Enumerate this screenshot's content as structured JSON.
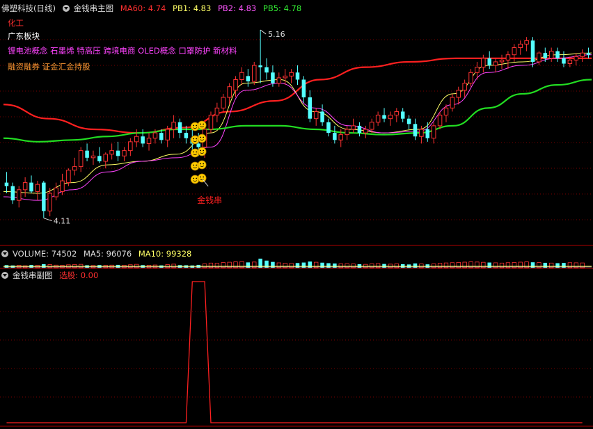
{
  "header": {
    "stock_name": "佛塑科技(日线)",
    "indicator_name": "金钱串主图",
    "ma60_label": "MA60:",
    "ma60_value": "4.74",
    "pb1_label": "PB1:",
    "pb1_value": "4.83",
    "pb2_label": "PB2:",
    "pb2_value": "4.83",
    "pb5_label": "PB5:",
    "pb5_value": "4.78"
  },
  "annotations": {
    "industry": "化工",
    "region": "广东板块",
    "concepts": "锂电池概念 石墨烯 特高压 跨境电商 OLED概念 口罩防护 新材料",
    "tags": "融资融券 证金汇金持股",
    "high_label": "5.16",
    "low_label": "4.11",
    "signal_label": "金钱串"
  },
  "volume_header": {
    "label": "VOLUME:",
    "value": "74502",
    "ma5_label": "MA5:",
    "ma5_value": "96076",
    "ma10_label": "MA10:",
    "ma10_value": "99328"
  },
  "sub_header": {
    "indicator_name": "金钱串副图",
    "select_label": "选股:",
    "select_value": "0.00"
  },
  "colors": {
    "up": "#ff3232",
    "down": "#54ffff",
    "ma60": "#ff2020",
    "pb1": "#ffff66",
    "pb2": "#ff44ff",
    "pb5": "#22dd22",
    "grid": "#7a0000",
    "signal": "#ff2020"
  },
  "chart_data": [
    {
      "type": "candlestick",
      "title": "金钱串主图",
      "ylim": [
        3.95,
        5.25
      ],
      "ohlc": [
        [
          4.3,
          4.36,
          4.24,
          4.28
        ],
        [
          4.28,
          4.3,
          4.18,
          4.2
        ],
        [
          4.2,
          4.28,
          4.16,
          4.26
        ],
        [
          4.26,
          4.33,
          4.22,
          4.3
        ],
        [
          4.3,
          4.34,
          4.24,
          4.25
        ],
        [
          4.25,
          4.31,
          4.2,
          4.29
        ],
        [
          4.3,
          4.31,
          4.1,
          4.14
        ],
        [
          4.14,
          4.27,
          4.11,
          4.24
        ],
        [
          4.22,
          4.3,
          4.2,
          4.27
        ],
        [
          4.25,
          4.35,
          4.23,
          4.31
        ],
        [
          4.3,
          4.38,
          4.28,
          4.37
        ],
        [
          4.37,
          4.44,
          4.34,
          4.39
        ],
        [
          4.39,
          4.5,
          4.36,
          4.48
        ],
        [
          4.48,
          4.52,
          4.42,
          4.44
        ],
        [
          4.44,
          4.48,
          4.4,
          4.45
        ],
        [
          4.45,
          4.5,
          4.41,
          4.42
        ],
        [
          4.42,
          4.47,
          4.38,
          4.46
        ],
        [
          4.46,
          4.52,
          4.43,
          4.48
        ],
        [
          4.48,
          4.53,
          4.42,
          4.45
        ],
        [
          4.45,
          4.5,
          4.42,
          4.48
        ],
        [
          4.48,
          4.55,
          4.45,
          4.53
        ],
        [
          4.53,
          4.6,
          4.5,
          4.56
        ],
        [
          4.56,
          4.6,
          4.5,
          4.52
        ],
        [
          4.52,
          4.58,
          4.48,
          4.55
        ],
        [
          4.55,
          4.6,
          4.52,
          4.58
        ],
        [
          4.58,
          4.6,
          4.52,
          4.54
        ],
        [
          4.54,
          4.62,
          4.5,
          4.6
        ],
        [
          4.6,
          4.68,
          4.55,
          4.64
        ],
        [
          4.64,
          4.66,
          4.55,
          4.58
        ],
        [
          4.58,
          4.62,
          4.52,
          4.55
        ],
        [
          4.55,
          4.6,
          4.48,
          4.52
        ],
        [
          4.52,
          4.58,
          4.45,
          4.5
        ],
        [
          4.5,
          4.62,
          4.44,
          4.6
        ],
        [
          4.6,
          4.7,
          4.58,
          4.68
        ],
        [
          4.68,
          4.75,
          4.64,
          4.72
        ],
        [
          4.72,
          4.8,
          4.7,
          4.78
        ],
        [
          4.78,
          4.86,
          4.74,
          4.84
        ],
        [
          4.82,
          4.9,
          4.78,
          4.88
        ],
        [
          4.88,
          4.95,
          4.85,
          4.92
        ],
        [
          4.9,
          4.94,
          4.84,
          4.87
        ],
        [
          4.87,
          4.98,
          4.85,
          4.96
        ],
        [
          4.96,
          5.16,
          4.86,
          4.95
        ],
        [
          4.95,
          5.0,
          4.88,
          4.92
        ],
        [
          4.92,
          4.96,
          4.84,
          4.86
        ],
        [
          4.86,
          4.92,
          4.84,
          4.89
        ],
        [
          4.89,
          4.94,
          4.85,
          4.9
        ],
        [
          4.9,
          4.94,
          4.86,
          4.92
        ],
        [
          4.92,
          4.96,
          4.85,
          4.88
        ],
        [
          4.88,
          4.9,
          4.75,
          4.78
        ],
        [
          4.78,
          4.82,
          4.64,
          4.66
        ],
        [
          4.66,
          4.72,
          4.62,
          4.7
        ],
        [
          4.7,
          4.74,
          4.62,
          4.64
        ],
        [
          4.64,
          4.66,
          4.56,
          4.58
        ],
        [
          4.58,
          4.62,
          4.52,
          4.54
        ],
        [
          4.54,
          4.6,
          4.5,
          4.57
        ],
        [
          4.57,
          4.62,
          4.54,
          4.6
        ],
        [
          4.6,
          4.66,
          4.58,
          4.62
        ],
        [
          4.62,
          4.64,
          4.56,
          4.58
        ],
        [
          4.58,
          4.62,
          4.55,
          4.6
        ],
        [
          4.6,
          4.66,
          4.58,
          4.64
        ],
        [
          4.64,
          4.7,
          4.62,
          4.68
        ],
        [
          4.68,
          4.72,
          4.64,
          4.66
        ],
        [
          4.66,
          4.7,
          4.62,
          4.68
        ],
        [
          4.68,
          4.72,
          4.64,
          4.7
        ],
        [
          4.7,
          4.72,
          4.64,
          4.66
        ],
        [
          4.66,
          4.68,
          4.6,
          4.63
        ],
        [
          4.63,
          4.66,
          4.54,
          4.56
        ],
        [
          4.56,
          4.62,
          4.52,
          4.6
        ],
        [
          4.6,
          4.64,
          4.53,
          4.55
        ],
        [
          4.55,
          4.64,
          4.52,
          4.62
        ],
        [
          4.62,
          4.7,
          4.6,
          4.68
        ],
        [
          4.68,
          4.74,
          4.64,
          4.72
        ],
        [
          4.72,
          4.8,
          4.7,
          4.78
        ],
        [
          4.78,
          4.84,
          4.74,
          4.82
        ],
        [
          4.82,
          4.88,
          4.78,
          4.86
        ],
        [
          4.86,
          4.94,
          4.84,
          4.92
        ],
        [
          4.92,
          4.98,
          4.88,
          4.95
        ],
        [
          4.95,
          5.02,
          4.92,
          5.0
        ],
        [
          5.0,
          5.04,
          4.94,
          4.96
        ],
        [
          4.96,
          5.0,
          4.92,
          4.98
        ],
        [
          4.98,
          5.02,
          4.94,
          4.99
        ],
        [
          4.99,
          5.04,
          4.94,
          5.02
        ],
        [
          5.02,
          5.08,
          4.98,
          5.06
        ],
        [
          5.06,
          5.1,
          5.02,
          5.08
        ],
        [
          5.08,
          5.12,
          5.04,
          5.1
        ],
        [
          5.1,
          5.12,
          4.95,
          4.98
        ],
        [
          4.98,
          5.04,
          4.96,
          5.03
        ],
        [
          5.03,
          5.06,
          4.98,
          5.0
        ],
        [
          5.0,
          5.06,
          4.98,
          5.04
        ],
        [
          5.04,
          5.06,
          4.98,
          5.0
        ],
        [
          5.0,
          5.04,
          4.95,
          4.97
        ],
        [
          4.97,
          5.01,
          4.95,
          4.99
        ],
        [
          4.99,
          5.03,
          4.96,
          5.01
        ],
        [
          5.01,
          5.05,
          4.98,
          5.03
        ],
        [
          5.03,
          5.06,
          5.0,
          5.02
        ]
      ],
      "series": [
        {
          "name": "MA60",
          "values": [
            4.74,
            4.66,
            4.6,
            4.58,
            4.61,
            4.7,
            4.76,
            4.88,
            4.95,
            4.98,
            5.0,
            5.0,
            5.0,
            5.0
          ]
        },
        {
          "name": "PB1",
          "values": [
            4.25,
            4.24,
            4.3,
            4.4,
            4.42,
            4.46,
            4.58,
            4.86,
            4.88,
            4.7,
            4.6,
            4.58,
            4.6,
            4.8,
            4.96,
            4.98,
            5.02,
            5.03
          ]
        },
        {
          "name": "PB2",
          "values": [
            4.22,
            4.2,
            4.26,
            4.36,
            4.42,
            4.44,
            4.5,
            4.82,
            4.86,
            4.72,
            4.62,
            4.58,
            4.59,
            4.74,
            4.92,
            4.96,
            5.0,
            5.02
          ]
        },
        {
          "name": "PB5",
          "values": [
            4.55,
            4.53,
            4.54,
            4.56,
            4.58,
            4.6,
            4.6,
            4.62,
            4.62,
            4.6,
            4.58,
            4.57,
            4.58,
            4.62,
            4.72,
            4.8,
            4.85,
            4.88
          ]
        }
      ],
      "signal_count": 5
    },
    {
      "type": "bar",
      "title": "VOLUME",
      "values": [
        40,
        35,
        38,
        30,
        42,
        36,
        55,
        48,
        40,
        37,
        45,
        50,
        52,
        38,
        34,
        41,
        36,
        40,
        44,
        39,
        46,
        52,
        40,
        38,
        42,
        36,
        48,
        55,
        40,
        38,
        35,
        44,
        60,
        72,
        68,
        80,
        85,
        90,
        95,
        82,
        88,
        140,
        110,
        90,
        75,
        70,
        66,
        72,
        80,
        95,
        85,
        78,
        70,
        65,
        60,
        62,
        58,
        55,
        52,
        60,
        64,
        58,
        55,
        60,
        54,
        50,
        66,
        58,
        52,
        60,
        70,
        74,
        78,
        82,
        86,
        90,
        88,
        84,
        80,
        76,
        72,
        78,
        82,
        86,
        90,
        84,
        80,
        76,
        72,
        70,
        74,
        78,
        76,
        74
      ]
    },
    {
      "type": "line",
      "title": "金钱串副图",
      "name": "选股",
      "values": [
        0,
        0,
        0,
        0,
        0,
        0,
        0,
        0,
        0,
        0,
        0,
        0,
        0,
        0,
        0,
        0,
        0,
        0,
        0,
        0,
        0,
        0,
        0,
        0,
        0,
        0,
        0,
        0,
        0,
        0,
        1,
        1,
        1,
        0,
        0,
        0,
        0,
        0,
        0,
        0,
        0,
        0,
        0,
        0,
        0,
        0,
        0,
        0,
        0,
        0,
        0,
        0,
        0,
        0,
        0,
        0,
        0,
        0,
        0,
        0,
        0,
        0,
        0,
        0,
        0,
        0,
        0,
        0,
        0,
        0,
        0,
        0,
        0,
        0,
        0,
        0,
        0,
        0,
        0,
        0,
        0,
        0,
        0,
        0,
        0,
        0,
        0,
        0,
        0,
        0,
        0,
        0,
        0,
        0
      ],
      "ylim": [
        0,
        1
      ]
    }
  ]
}
